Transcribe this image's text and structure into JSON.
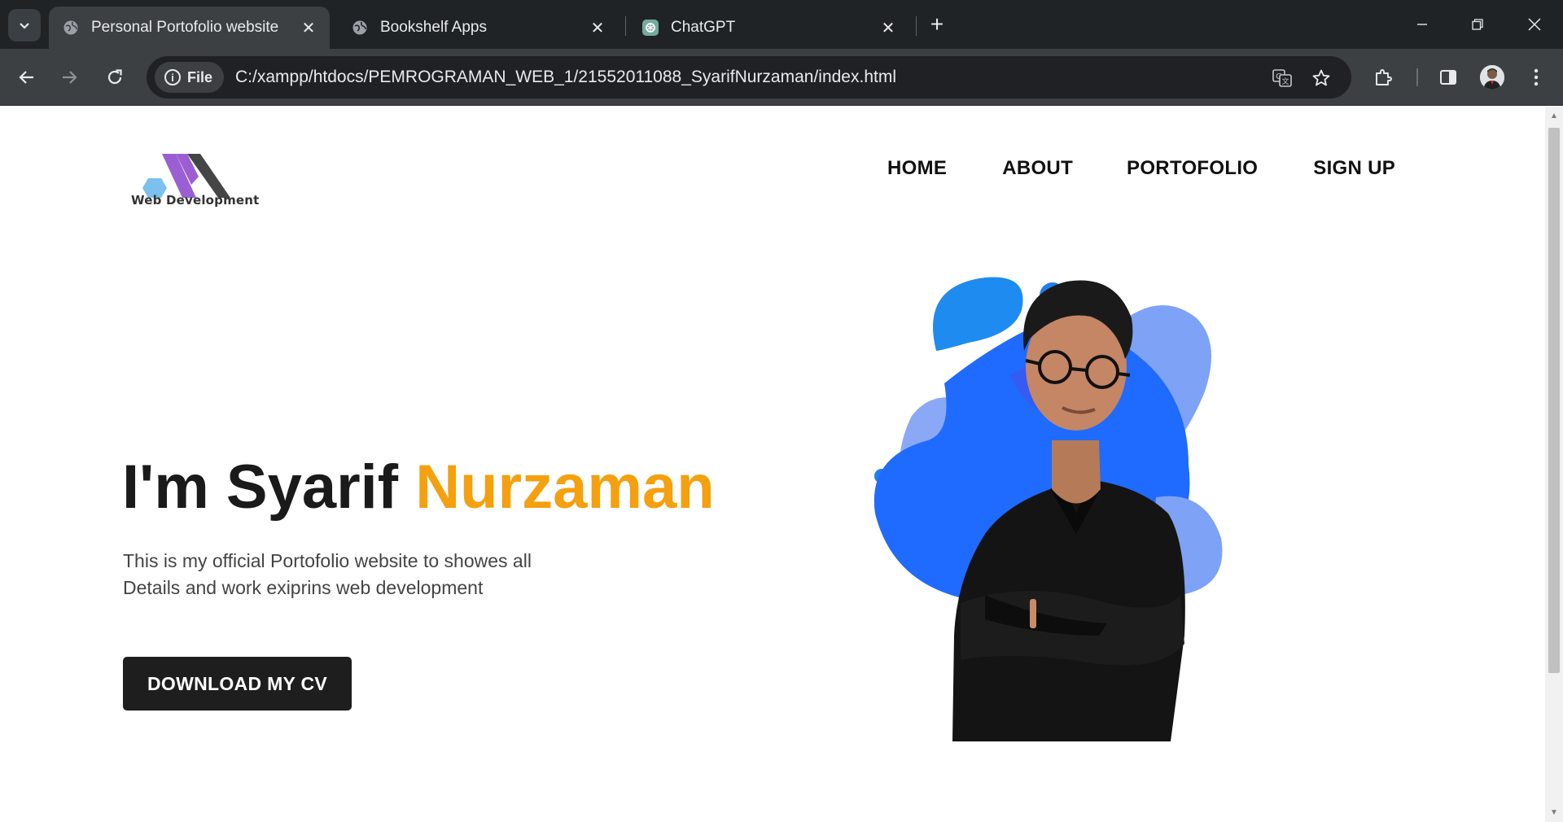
{
  "browser": {
    "tabs": [
      {
        "title": "Personal Portofolio website",
        "active": true
      },
      {
        "title": "Bookshelf Apps",
        "active": false
      },
      {
        "title": "ChatGPT",
        "active": false
      }
    ],
    "address": {
      "scheme_chip": "File",
      "url": "C:/xampp/htdocs/PEMROGRAMAN_WEB_1/21552011088_SyarifNurzaman/index.html"
    }
  },
  "site": {
    "logo_text": "Web Development",
    "nav": [
      "HOME",
      "ABOUT",
      "PORTOFOLIO",
      "SIGN UP"
    ],
    "hero": {
      "title_prefix": "I'm Syarif ",
      "title_accent": "Nurzaman",
      "description_line1": "This is my official Portofolio website to showes all",
      "description_line2": "Details and work exiprins web development",
      "cta_label": "DOWNLOAD MY CV"
    }
  },
  "colors": {
    "accent": "#f5a00f",
    "button_bg": "#1e1e1e",
    "blob_blue": "#1f6bff",
    "blob_light": "#7ea2f5"
  }
}
